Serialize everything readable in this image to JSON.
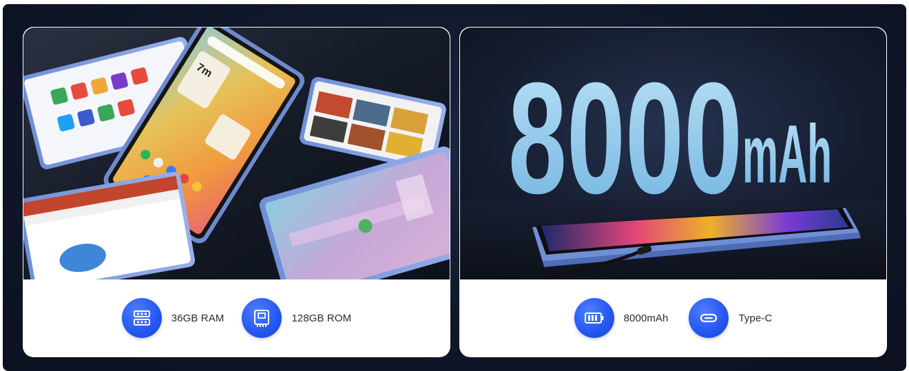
{
  "left_card": {
    "features": [
      {
        "label": "36GB RAM",
        "icon": "ram-chip-icon"
      },
      {
        "label": "128GB ROM",
        "icon": "storage-chip-icon"
      }
    ],
    "tablet_screen_text": "7m"
  },
  "right_card": {
    "headline_number": "8000",
    "headline_unit": "mAh",
    "features": [
      {
        "label": "8000mAh",
        "icon": "battery-icon"
      },
      {
        "label": "Type-C",
        "icon": "usb-c-port-icon"
      }
    ]
  },
  "colors": {
    "background": "#0f1729",
    "icon_blue": "#2456f0",
    "card_white": "#ffffff",
    "headline_blue": "#8fc6ea"
  }
}
